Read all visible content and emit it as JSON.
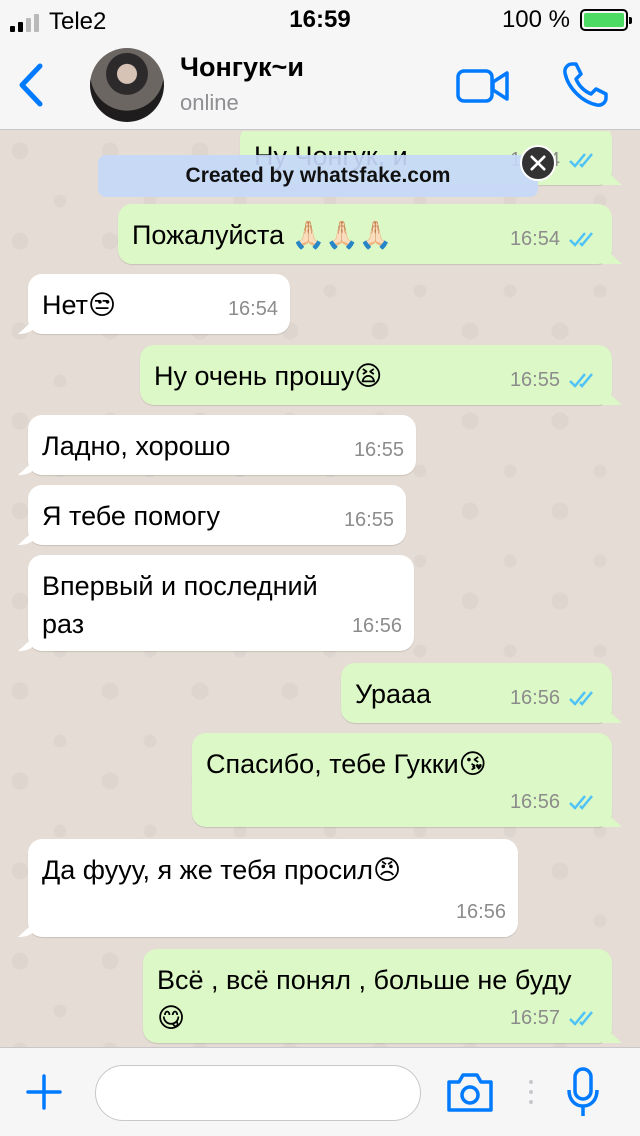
{
  "status_bar": {
    "carrier": "Tele2",
    "time": "16:59",
    "battery_percent": "100 %",
    "battery_level": 1.0
  },
  "header": {
    "contact_name": "Чонгук~и",
    "status": "online"
  },
  "watermark": {
    "text": "Created by whatsfake.com"
  },
  "messages": [
    {
      "direction": "out",
      "text": "Ну Чонгук, и",
      "time": "16:54",
      "ticks": "read"
    },
    {
      "direction": "out",
      "text": "Пожалуйста 🙏🏻🙏🏻🙏🏻",
      "time": "16:54",
      "ticks": "read"
    },
    {
      "direction": "in",
      "text": "Нет😒",
      "time": "16:54"
    },
    {
      "direction": "out",
      "text": "Ну очень прошу😫",
      "time": "16:55",
      "ticks": "read"
    },
    {
      "direction": "in",
      "text": "Ладно, хорошо",
      "time": "16:55"
    },
    {
      "direction": "in",
      "text": "Я тебе помогу",
      "time": "16:55"
    },
    {
      "direction": "in",
      "text": "Впервый и последний раз",
      "time": "16:56"
    },
    {
      "direction": "out",
      "text": "Урааа",
      "time": "16:56",
      "ticks": "read"
    },
    {
      "direction": "out",
      "text": "Спасибо, тебе Гукки😘",
      "time": "16:56",
      "ticks": "read"
    },
    {
      "direction": "in",
      "text": "Да фууу, я же тебя просил😠",
      "time": "16:56"
    },
    {
      "direction": "out",
      "text": "Всё , всё понял , больше не буду😋",
      "time": "16:57",
      "ticks": "read"
    }
  ],
  "input": {
    "placeholder": ""
  },
  "colors": {
    "accent": "#007aff",
    "outgoing_bubble": "#dcf8c6",
    "incoming_bubble": "#ffffff",
    "read_ticks": "#4fc3f7",
    "chat_background": "#e5ddd5",
    "battery": "#4cd964"
  },
  "icons": {
    "back": "chevron-left-icon",
    "video": "video-camera-icon",
    "call": "phone-icon",
    "plus": "plus-icon",
    "camera": "camera-icon",
    "mic": "microphone-icon",
    "ticks": "double-check-icon",
    "close": "close-icon"
  }
}
